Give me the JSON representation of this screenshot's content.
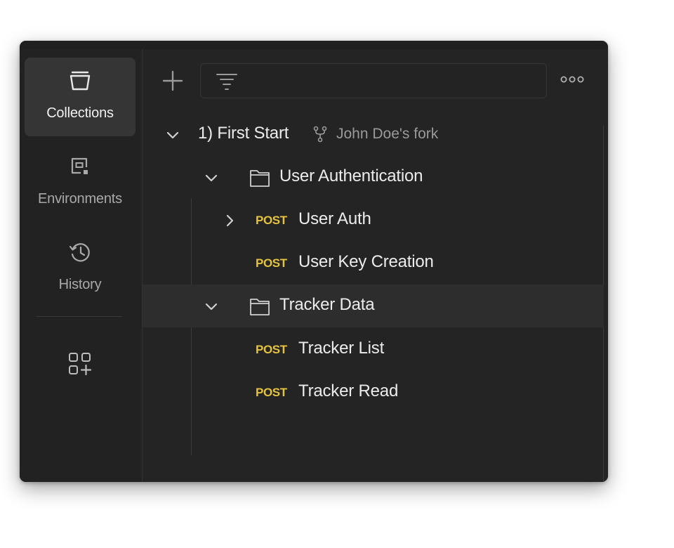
{
  "sidebar": {
    "items": [
      {
        "label": "Collections",
        "icon": "collections-icon",
        "active": true
      },
      {
        "label": "Environments",
        "icon": "environments-icon",
        "active": false
      },
      {
        "label": "History",
        "icon": "history-icon",
        "active": false
      }
    ],
    "apps_icon": "apps-add-icon"
  },
  "toolbar": {
    "add_icon": "plus-icon",
    "filter_icon": "filter-icon",
    "filter_placeholder": "",
    "more_icon": "more-options-icon"
  },
  "tree": {
    "collection": {
      "name": "1) First Start",
      "fork_icon": "fork-icon",
      "fork_label": "John Doe's fork"
    },
    "folders": [
      {
        "name": "User Authentication",
        "requests": [
          {
            "method": "POST",
            "name": "User Auth"
          },
          {
            "method": "POST",
            "name": "User Key Creation"
          }
        ]
      },
      {
        "name": "Tracker Data",
        "requests": [
          {
            "method": "POST",
            "name": "Tracker List"
          },
          {
            "method": "POST",
            "name": "Tracker Read"
          }
        ]
      }
    ]
  },
  "colors": {
    "background": "#242424",
    "sidebar": "#222222",
    "active_nav": "#353535",
    "method_post": "#e6c33d",
    "text": "#ececec",
    "muted": "#9a9a9a"
  }
}
